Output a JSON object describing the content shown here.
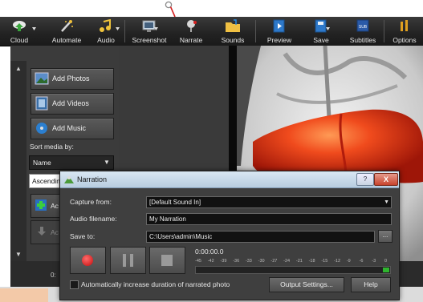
{
  "toolbar": {
    "items": [
      {
        "label": "Cloud",
        "icon": "cloud-upload-icon"
      },
      {
        "label": "Automate",
        "icon": "magic-wand-icon"
      },
      {
        "label": "Audio",
        "icon": "music-note-icon"
      },
      {
        "label": "Screenshot",
        "icon": "screenshot-icon"
      },
      {
        "label": "Narrate",
        "icon": "microphone-icon"
      },
      {
        "label": "Sounds",
        "icon": "sounds-folder-icon"
      },
      {
        "label": "Preview",
        "icon": "preview-icon"
      },
      {
        "label": "Save",
        "icon": "save-icon"
      },
      {
        "label": "Subtitles",
        "icon": "subtitles-icon"
      },
      {
        "label": "Options",
        "icon": "options-icon"
      }
    ]
  },
  "left_panel": {
    "add_photos": "Add Photos",
    "add_videos": "Add Videos",
    "add_music": "Add Music",
    "sort_label": "Sort media by:",
    "sort_value": "Name",
    "order_value": "Ascendin",
    "partial_button_1": "Ac",
    "partial_button_2": "Ac"
  },
  "timeline": {
    "time": "0:"
  },
  "dialog": {
    "title": "Narration",
    "help_glyph": "?",
    "close_glyph": "X",
    "capture_label": "Capture from:",
    "capture_value": "[Default Sound In]",
    "filename_label": "Audio filename:",
    "filename_value": "My Narration",
    "save_label": "Save to:",
    "save_value": "C:\\Users\\admin\\Music",
    "browse_label": "...",
    "time": "0:00:00.0",
    "meter_scale": [
      "-45",
      "-42",
      "-39",
      "-36",
      "-33",
      "-30",
      "-27",
      "-24",
      "-21",
      "-18",
      "-15",
      "-12",
      "-9",
      "-6",
      "-3",
      "0"
    ],
    "auto_increase_label": "Automatically increase duration of narrated photo",
    "output_settings": "Output Settings...",
    "help": "Help"
  },
  "colors": {
    "record": "#d41414",
    "meter_green": "#2fb52f",
    "title_bar": "#c9dbe9"
  }
}
